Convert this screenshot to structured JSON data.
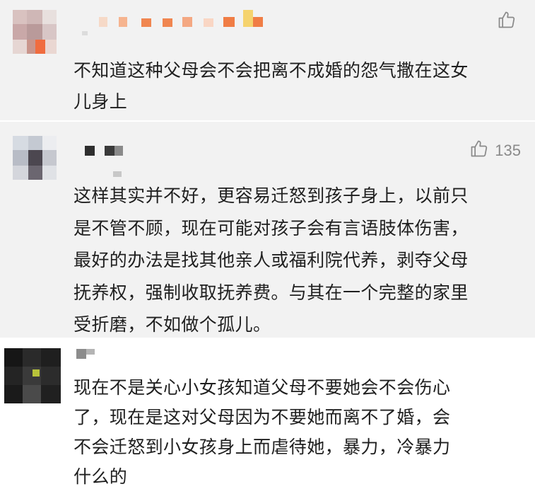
{
  "comments": [
    {
      "likes": "",
      "lines": [
        "不知道这种父母会不会把离不成婚的怨气撒在这女",
        "儿身上"
      ]
    },
    {
      "likes": "135",
      "lines": [
        "这样其实并不好，更容易迁怒到孩子身上，以前只",
        "是不管不顾，现在可能对孩子会有言语肢体伤害，",
        "最好的办法是找其他亲人或福利院代养，剥夺父母",
        "抚养权，强制收取抚养费。与其在一个完整的家里",
        "受折磨，不如做个孤儿。"
      ]
    },
    {
      "likes": "",
      "lines": [
        "现在不是关心小女孩知道父母不要她会不会伤心",
        "了，现在是这对父母因为不要她而离不了婚，会",
        "不会迁怒到小女孩身上而虐待她，暴力，冷暴力",
        "什么的"
      ]
    }
  ],
  "icons": {
    "like": "thumbs-up-icon"
  },
  "colors": {
    "comment_bg_gray": "#f2f2f2",
    "comment_bg_white": "#ffffff",
    "text": "#1f1f1f",
    "meta": "#8a8a8a"
  }
}
